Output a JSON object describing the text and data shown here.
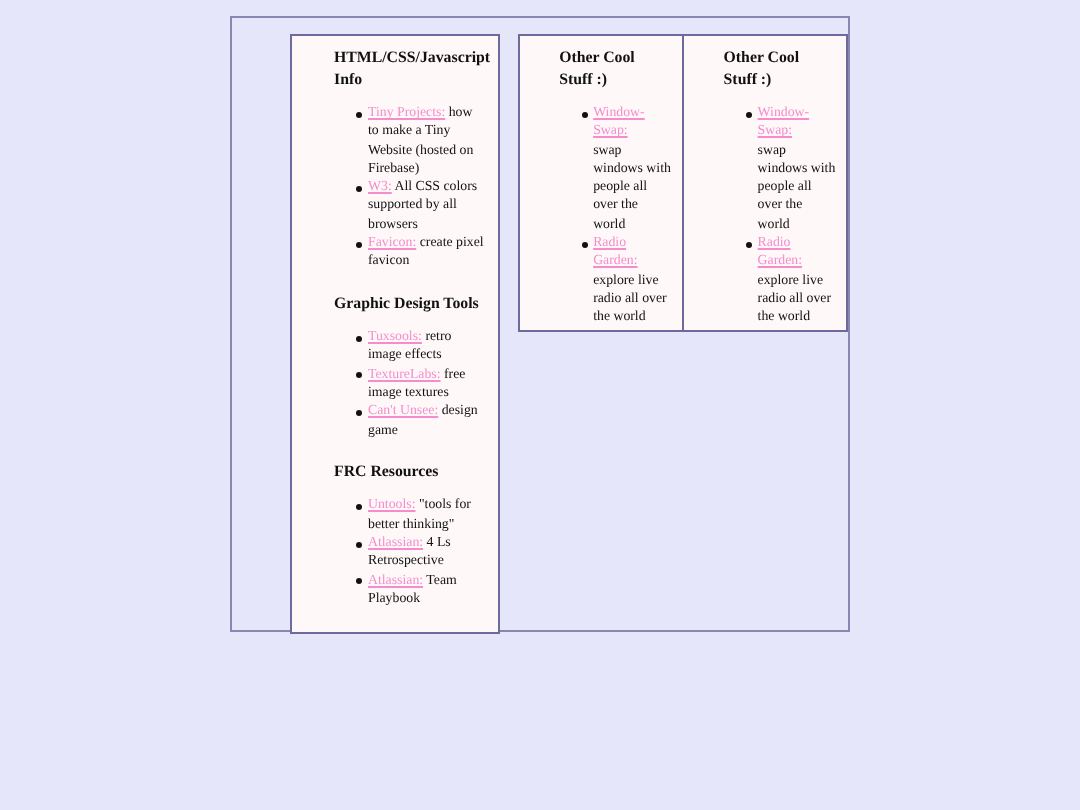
{
  "panels": [
    {
      "sections": [
        {
          "heading": "HTML/CSS/Javascript Info",
          "items": [
            {
              "link": "Tiny Projects:",
              "text": "how to make a Tiny Website (hosted on Firebase)"
            },
            {
              "link": "W3:",
              "text": "All CSS colors supported by all browsers"
            },
            {
              "link": "Favicon:",
              "text": "create pixel favicon"
            }
          ]
        },
        {
          "heading": "Graphic Design Tools",
          "items": [
            {
              "link": "Tuxsools:",
              "text": "retro image effects"
            },
            {
              "link": "TextureLabs:",
              "text": "free image textures"
            },
            {
              "link": "Can't Unsee:",
              "text": "design game"
            }
          ]
        },
        {
          "heading": "FRC Resources",
          "items": [
            {
              "link": "Untools:",
              "text": "\"tools for better thinking\""
            },
            {
              "link": "Atlassian:",
              "text": "4 Ls Retrospective"
            },
            {
              "link": "Atlassian:",
              "text": "Team Playbook"
            }
          ]
        }
      ]
    },
    {
      "sections": [
        {
          "heading": "Other Cool Stuff :)",
          "items": [
            {
              "link": "Window-Swap:",
              "text": "swap windows with people all over the world"
            },
            {
              "link": "Radio Garden:",
              "text": "explore live radio all over the world"
            }
          ]
        }
      ]
    },
    {
      "sections": [
        {
          "heading": "Other Cool Stuff :)",
          "items": [
            {
              "link": "Window-Swap:",
              "text": "swap windows with people all over the world"
            },
            {
              "link": "Radio Garden:",
              "text": "explore live radio all over the world"
            }
          ]
        }
      ]
    }
  ]
}
